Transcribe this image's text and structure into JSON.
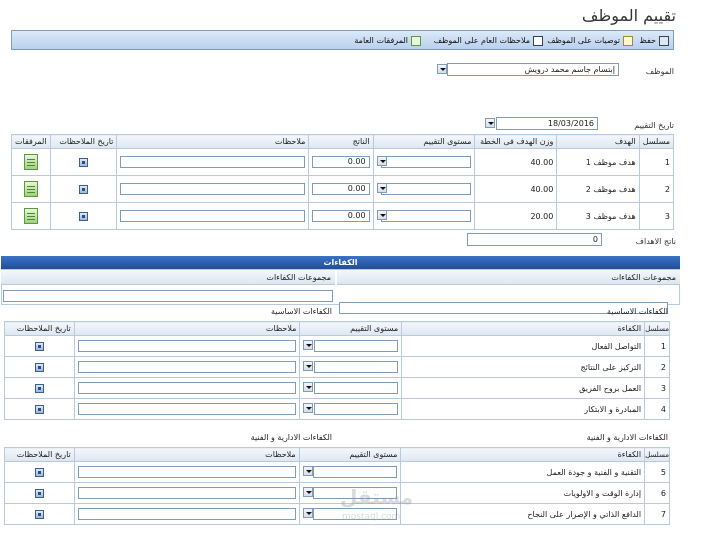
{
  "page": {
    "title": "تقييم الموظف"
  },
  "toolbar": {
    "save_label": "حفظ",
    "recommendations_label": "توصيات على الموظف",
    "general_notes_label": "ملاحظات العام على الموظف",
    "general_attachments_label": "المرفقات العامة"
  },
  "employee": {
    "label": "الموظف",
    "value": "إبتسام جاسم محمد درويش"
  },
  "evaluation_date": {
    "label": "تاريخ التقييم",
    "value": "18/03/2016"
  },
  "goals": {
    "headers": {
      "serial": "مسلسل",
      "goal": "الهدف",
      "weight": "وزن الهدف فى الخطة",
      "rating": "مستوى التقييم",
      "result": "الناتج",
      "notes": "ملاحظات",
      "notes_date": "تاريخ الملاحظات",
      "attachments": "المرفقات"
    },
    "rows": [
      {
        "serial": "1",
        "goal": "هدف موظف 1",
        "weight": "40.00",
        "result": "0.00"
      },
      {
        "serial": "2",
        "goal": "هدف موظف 2",
        "weight": "40.00",
        "result": "0.00"
      },
      {
        "serial": "3",
        "goal": "هدف موظف 3",
        "weight": "20.00",
        "result": "0.00"
      }
    ],
    "total_label": "ناتج الاهداف",
    "total_value": "0"
  },
  "competencies": {
    "section_title": "الكفاءات",
    "groups_header_left": "مجموعات الكفاءات",
    "groups_header_right": "مجموعات الكفاءات",
    "headers": {
      "serial": "مسلسل",
      "competency": "الكفاءة",
      "rating": "مستوى التقييم",
      "notes": "ملاحظات",
      "notes_date": "تاريخ الملاحظات"
    },
    "groups": [
      {
        "name": "الكفاءات الاساسية",
        "name_right": "الكفاءات الاساسية",
        "rows": [
          {
            "serial": "1",
            "name": "التواصل الفعال"
          },
          {
            "serial": "2",
            "name": "التركيز على النتائج"
          },
          {
            "serial": "3",
            "name": "العمل بروح الفريق"
          },
          {
            "serial": "4",
            "name": "المبادرة و الابتكار"
          }
        ]
      },
      {
        "name": "الكفاءات الادارية و الفنية",
        "name_right": "الكفاءات الادارية و الفنية",
        "rows": [
          {
            "serial": "5",
            "name": "التقنية و الفنية و جودة العمل"
          },
          {
            "serial": "6",
            "name": "إدارة الوقت و الاولويات"
          },
          {
            "serial": "7",
            "name": "الدافع الذاتي و الإصرار على النجاح"
          }
        ]
      }
    ]
  },
  "watermark": {
    "main": "مستقل",
    "sub": "mostaql.com"
  },
  "colors": {
    "header_band": "#214e97",
    "toolbar": "#c9daf1",
    "border": "#7f9db9"
  }
}
